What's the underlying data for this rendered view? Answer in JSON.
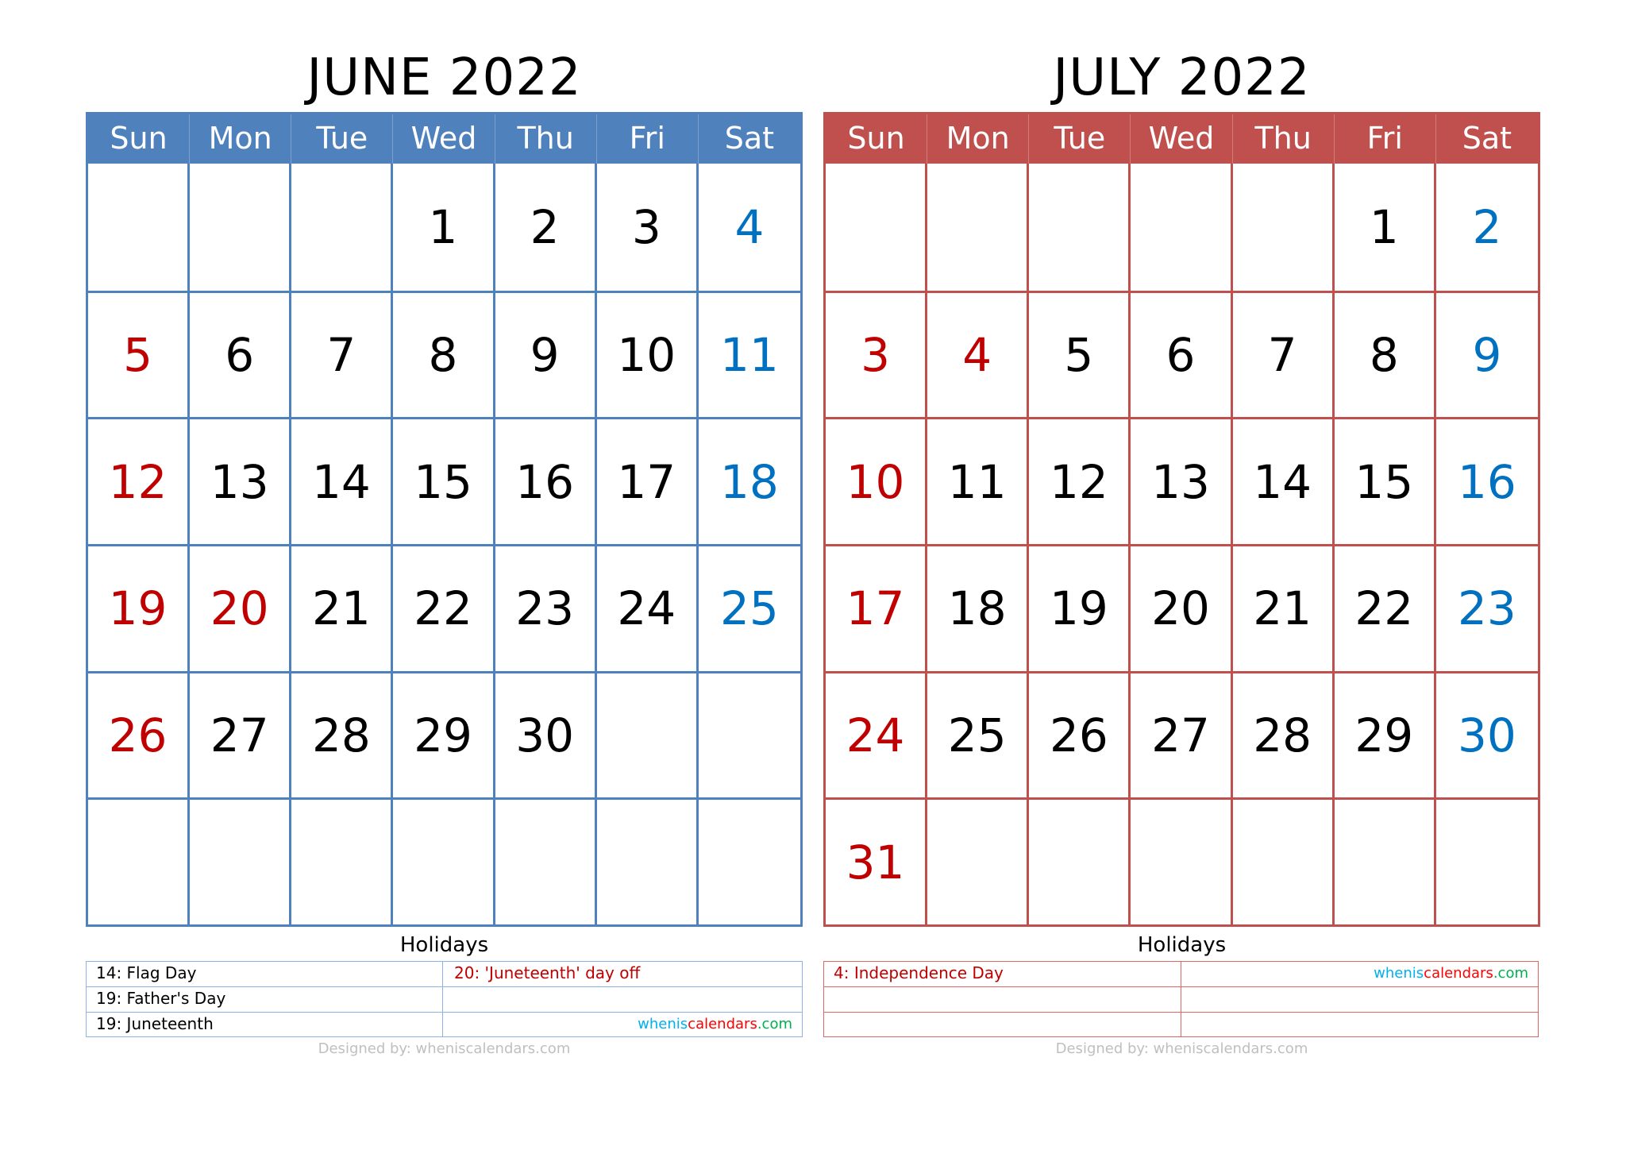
{
  "colors": {
    "june_accent": "#4F81BD",
    "july_accent": "#C0504D",
    "sunday_holiday_red": "#C00000",
    "saturday_blue": "#0070C0",
    "watermark_whenis": "#00B0F0",
    "watermark_calendars": "#FF0000",
    "watermark_com": "#00B050",
    "designed_gray": "#BFBFBF"
  },
  "weekdays": [
    "Sun",
    "Mon",
    "Tue",
    "Wed",
    "Thu",
    "Fri",
    "Sat"
  ],
  "months": [
    {
      "title": "JUNE 2022",
      "weeks": [
        [
          "",
          "",
          "",
          "1",
          "2",
          "3",
          "4"
        ],
        [
          "5",
          "6",
          "7",
          "8",
          "9",
          "10",
          "11"
        ],
        [
          "12",
          "13",
          "14",
          "15",
          "16",
          "17",
          "18"
        ],
        [
          "19",
          "20",
          "21",
          "22",
          "23",
          "24",
          "25"
        ],
        [
          "26",
          "27",
          "28",
          "29",
          "30",
          "",
          ""
        ],
        [
          "",
          "",
          "",
          "",
          "",
          "",
          ""
        ]
      ],
      "holiday_dates": [
        "20"
      ],
      "holidays_label": "Holidays",
      "holidays_table": [
        [
          "14: Flag Day",
          "20: 'Juneteenth' day off"
        ],
        [
          "19: Father's Day",
          ""
        ],
        [
          "19: Juneteenth",
          ""
        ]
      ],
      "red_holiday_cells": [
        "0-1"
      ],
      "watermark_cell": "2-1",
      "designed_by": "Designed by: wheniscalendars.com"
    },
    {
      "title": "JULY 2022",
      "weeks": [
        [
          "",
          "",
          "",
          "",
          "",
          "1",
          "2"
        ],
        [
          "3",
          "4",
          "5",
          "6",
          "7",
          "8",
          "9"
        ],
        [
          "10",
          "11",
          "12",
          "13",
          "14",
          "15",
          "16"
        ],
        [
          "17",
          "18",
          "19",
          "20",
          "21",
          "22",
          "23"
        ],
        [
          "24",
          "25",
          "26",
          "27",
          "28",
          "29",
          "30"
        ],
        [
          "31",
          "",
          "",
          "",
          "",
          "",
          ""
        ]
      ],
      "holiday_dates": [
        "4"
      ],
      "holidays_label": "Holidays",
      "holidays_table": [
        [
          "4: Independence Day",
          ""
        ],
        [
          "",
          ""
        ],
        [
          "",
          ""
        ]
      ],
      "red_holiday_cells": [
        "0-0"
      ],
      "watermark_cell": "0-1",
      "designed_by": "Designed by: wheniscalendars.com"
    }
  ],
  "watermark": {
    "part1": "whenis",
    "part2": "calendars",
    "part3": ".com"
  }
}
